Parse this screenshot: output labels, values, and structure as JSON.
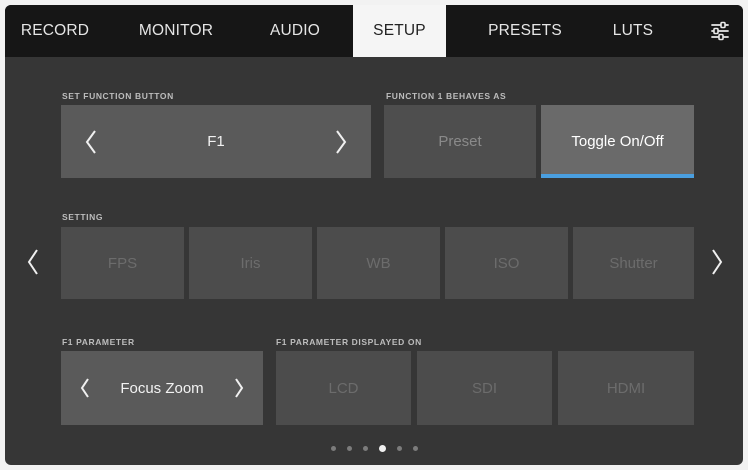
{
  "tabs": [
    {
      "label": "RECORD",
      "active": false
    },
    {
      "label": "MONITOR",
      "active": false
    },
    {
      "label": "AUDIO",
      "active": false
    },
    {
      "label": "SETUP",
      "active": true
    },
    {
      "label": "PRESETS",
      "active": false
    },
    {
      "label": "LUTS",
      "active": false
    }
  ],
  "icons": {
    "settings": "sliders-icon",
    "prev": "chevron-left-icon",
    "next": "chevron-right-icon"
  },
  "colors": {
    "accent": "#4a9fe0",
    "tabbar": "#161616",
    "active_tab": "#f5f5f5",
    "panel": "#363636"
  },
  "function_button": {
    "label": "SET FUNCTION BUTTON",
    "value": "F1"
  },
  "behaves_as": {
    "label": "FUNCTION 1 BEHAVES AS",
    "options": [
      {
        "label": "Preset",
        "selected": false
      },
      {
        "label": "Toggle On/Off",
        "selected": true
      }
    ]
  },
  "setting": {
    "label": "SETTING",
    "options": [
      "FPS",
      "Iris",
      "WB",
      "ISO",
      "Shutter"
    ]
  },
  "parameter": {
    "label": "F1 PARAMETER",
    "value": "Focus Zoom"
  },
  "displayed_on": {
    "label": "F1 PARAMETER DISPLAYED ON",
    "options": [
      "LCD",
      "SDI",
      "HDMI"
    ]
  },
  "pagination": {
    "pages": 6,
    "current": 4
  }
}
